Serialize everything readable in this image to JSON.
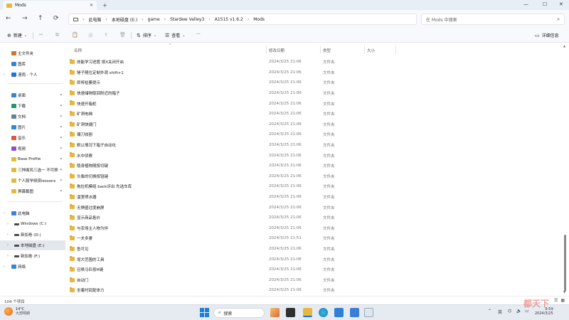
{
  "window": {
    "tab_title": "Mods",
    "tab_close": "✕",
    "tab_add": "+",
    "controls": {
      "minimize": "—",
      "maximize": "☐",
      "close": "✕"
    }
  },
  "nav": {
    "back": "←",
    "forward": "→",
    "up": "↑",
    "refresh": "⟳",
    "breadcrumbs": [
      "此电脑",
      "本地磁盘 (E:)",
      "game",
      "Stardew Valley3",
      "A1515 v1.6.2",
      "Mods"
    ],
    "crumb_sep": "›",
    "search_placeholder": "在 Mods 中搜索"
  },
  "toolbar": {
    "new_label": "新建",
    "sort_label": "排序",
    "view_label": "查看",
    "more_label": "···",
    "details_label": "详细信息"
  },
  "columns": {
    "name": "名称",
    "date": "修改日期",
    "type": "类型",
    "size": "大小"
  },
  "sidebar": {
    "items": [
      {
        "label": "主文件夹",
        "icon": "home-icon",
        "color": "#c9752c"
      },
      {
        "label": "图库",
        "icon": "gallery-icon",
        "color": "#3a84d8"
      },
      {
        "label": "漫雨 - 个人",
        "icon": "cloud-icon",
        "color": "#1e73d8"
      },
      {
        "label": "桌面",
        "icon": "desktop-icon",
        "color": "#3a84d8"
      },
      {
        "label": "下载",
        "icon": "download-icon",
        "color": "#1e9a6b"
      },
      {
        "label": "文档",
        "icon": "document-icon",
        "color": "#6a7f98"
      },
      {
        "label": "图片",
        "icon": "picture-icon",
        "color": "#3a84d8"
      },
      {
        "label": "音乐",
        "icon": "music-icon",
        "color": "#e0553b"
      },
      {
        "label": "视频",
        "icon": "video-icon",
        "color": "#8a4fd0"
      },
      {
        "label": "Base Profile",
        "icon": "folder-icon",
        "color": "#e7b740"
      },
      {
        "label": "三种面风三选一 不可移",
        "icon": "folder-icon",
        "color": "#e7b740"
      },
      {
        "label": "个人股学频资lessons",
        "icon": "folder-icon",
        "color": "#e7b740"
      },
      {
        "label": "屏幕截图",
        "icon": "folder-icon",
        "color": "#e7b740"
      },
      {
        "label": "此电脑",
        "icon": "pc-icon",
        "color": "#3a84d8"
      },
      {
        "label": "Windows (C:)",
        "icon": "drive-icon",
        "color": "#4a4a4a"
      },
      {
        "label": "新加卷 (D:)",
        "icon": "drive-icon",
        "color": "#4a4a4a"
      },
      {
        "label": "本地磁盘 (E:)",
        "icon": "drive-icon",
        "color": "#4a4a4a"
      },
      {
        "label": "新加卷 (F:)",
        "icon": "drive-icon",
        "color": "#4a4a4a"
      },
      {
        "label": "网络",
        "icon": "network-icon",
        "color": "#3a84d8"
      }
    ],
    "pin": "📌"
  },
  "files": [
    {
      "name": "技能学习进度 按X关闭开启",
      "date": "2024/3/25 21:06",
      "type": "文件夹"
    },
    {
      "name": "锤子随位定制外观 shift+1",
      "date": "2024/3/25 21:06",
      "type": "文件夹"
    },
    {
      "name": "即将枯萎提示",
      "date": "2024/3/25 21:06",
      "type": "文件夹"
    },
    {
      "name": "快速储物取回附近的箱子",
      "date": "2024/3/25 21:06",
      "type": "文件夹"
    },
    {
      "name": "快速开箱柜",
      "date": "2024/3/25 21:06",
      "type": "文件夹"
    },
    {
      "name": "矿洞电梯",
      "date": "2024/3/25 21:06",
      "type": "文件夹"
    },
    {
      "name": "矿洞快捷门",
      "date": "2024/3/25 21:06",
      "type": "文件夹"
    },
    {
      "name": "镰刀收割",
      "date": "2024/3/25 21:06",
      "type": "文件夹"
    },
    {
      "name": "默认情况下箱子自动化",
      "date": "2024/3/25 21:06",
      "type": "文件夹"
    },
    {
      "name": "水中侦察",
      "date": "2024/3/25 21:06",
      "type": "文件夹"
    },
    {
      "name": "隐身植物随按切键",
      "date": "2024/3/25 21:06",
      "type": "文件夹"
    },
    {
      "name": "头像的切换按钮键",
      "date": "2024/3/25 21:06",
      "type": "文件夹"
    },
    {
      "name": "拖拉机模组 back评出 先选车库",
      "date": "2024/3/25 21:06",
      "type": "文件夹"
    },
    {
      "name": "温室喷水器",
      "date": "2024/3/25 21:06",
      "type": "文件夹"
    },
    {
      "name": "无惧盛过度崩屏",
      "date": "2024/3/25 21:06",
      "type": "文件夹"
    },
    {
      "name": "显示商品售价",
      "date": "2024/3/25 21:06",
      "type": "文件夹"
    },
    {
      "name": "与农场主人物为伴",
      "date": "2024/3/25 21:06",
      "type": "文件夹"
    },
    {
      "name": "一夫多妻",
      "date": "2024/3/25 21:51",
      "type": "文件夹"
    },
    {
      "name": "鱼可见",
      "date": "2024/3/25 21:06",
      "type": "文件夹"
    },
    {
      "name": "增大范围的工具",
      "date": "2024/3/25 21:06",
      "type": "文件夹"
    },
    {
      "name": "召唤马匹按H键",
      "date": "2024/3/25 21:06",
      "type": "文件夹"
    },
    {
      "name": "自动门",
      "date": "2024/3/25 21:06",
      "type": "文件夹"
    },
    {
      "name": "坐着时回复体力",
      "date": "2024/3/25 21:06",
      "type": "文件夹"
    }
  ],
  "status": {
    "count": "104 个项目"
  },
  "taskbar": {
    "weather_temp": "14°C",
    "weather_desc": "大部晴朗",
    "search_label": "搜索",
    "ime": "英",
    "time": "9:59",
    "date": "2024/3/25"
  },
  "watermark": "都天下"
}
